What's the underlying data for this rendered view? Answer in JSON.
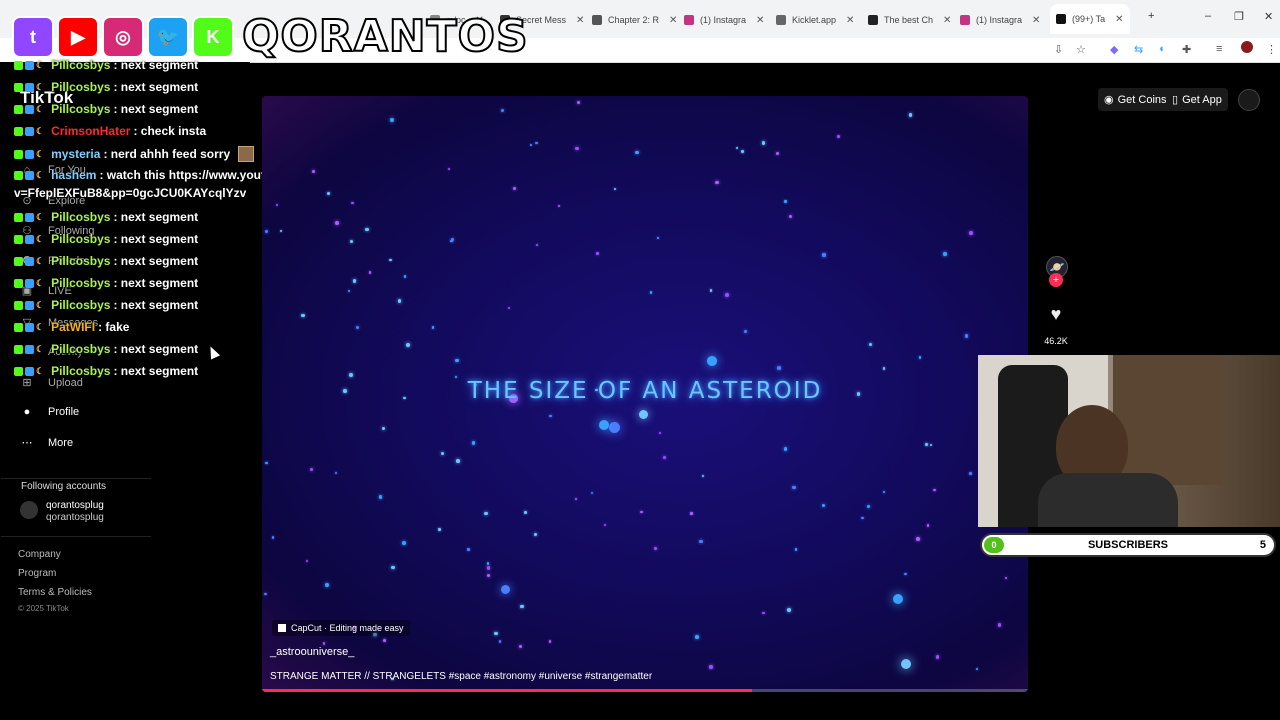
{
  "browser": {
    "tabs": [
      {
        "label": "m/pc",
        "color": "#888888"
      },
      {
        "label": "Secret Mess",
        "color": "#333333"
      },
      {
        "label": "Chapter 2: R",
        "color": "#555555"
      },
      {
        "label": "(1) Instagra",
        "color": "#c13584"
      },
      {
        "label": "Kicklet.app",
        "color": "#666666"
      },
      {
        "label": "The best Ch",
        "color": "#222222"
      },
      {
        "label": "(1) Instagra",
        "color": "#c13584"
      },
      {
        "label": "(99+) Ta",
        "color": "#111111"
      }
    ],
    "new_tab": "+",
    "minimize": "–",
    "restore": "❐",
    "close": "✕"
  },
  "overlay": {
    "brand": "QORANTOS",
    "logos": [
      {
        "name": "twitch-icon",
        "glyph": "t",
        "color": "#9146ff"
      },
      {
        "name": "youtube-icon",
        "glyph": "▶",
        "color": "#ff0000"
      },
      {
        "name": "instagram-icon",
        "glyph": "◎",
        "color": "#d62976"
      },
      {
        "name": "twitter-icon",
        "glyph": "🐦",
        "color": "#1da1f2"
      },
      {
        "name": "kick-icon",
        "glyph": "K",
        "color": "#53fc18"
      }
    ]
  },
  "tiktok": {
    "logo": "TikTok",
    "nav": [
      {
        "label": "For You",
        "icon": "home-icon",
        "glyph": "⌂"
      },
      {
        "label": "Explore",
        "icon": "explore-icon",
        "glyph": "⊙"
      },
      {
        "label": "Following",
        "icon": "following-icon",
        "glyph": "⚇"
      },
      {
        "label": "Friends",
        "icon": "friends-icon",
        "glyph": "⚉"
      },
      {
        "label": "LIVE",
        "icon": "live-icon",
        "glyph": "▣"
      },
      {
        "label": "Messages",
        "icon": "messages-icon",
        "glyph": "▽"
      },
      {
        "label": "Activity",
        "icon": "activity-icon",
        "glyph": "◔"
      },
      {
        "label": "Upload",
        "icon": "upload-icon",
        "glyph": "⊞"
      },
      {
        "label": "Profile",
        "icon": "profile-icon",
        "glyph": "●"
      },
      {
        "label": "More",
        "icon": "more-icon",
        "glyph": "⋯"
      }
    ],
    "following_heading": "Following accounts",
    "following_account": {
      "name": "qorantosplug",
      "handle": "qorantosplug"
    },
    "footer": [
      "Company",
      "Program",
      "Terms & Policies"
    ],
    "copyright": "© 2025 TikTok",
    "get_coins": "Get Coins",
    "get_app": "Get App",
    "like_count": "46.2K"
  },
  "chat": [
    {
      "user": "Pillcosbys",
      "color": "#a8f05a",
      "msg": ": next segment"
    },
    {
      "user": "Pillcosbys",
      "color": "#a8f05a",
      "msg": ": next segment"
    },
    {
      "user": "Pillcosbys",
      "color": "#a8f05a",
      "msg": ": next segment"
    },
    {
      "user": "CrimsonHater",
      "color": "#ff2a2a",
      "msg": ": check insta"
    },
    {
      "user": "mysteria",
      "color": "#7fd0ff",
      "msg": ": nerd ahhh feed sorry"
    },
    {
      "user": "hashem",
      "color": "#7fd0ff",
      "msg": ": watch this https://www.youtube.com/watch?"
    },
    {
      "user": "",
      "color": "#ffffff",
      "msg": "v=FfeplEXFuB8&pp=0gcJCU0KAYcqlYzv"
    },
    {
      "user": "Pillcosbys",
      "color": "#a8f05a",
      "msg": ": next segment"
    },
    {
      "user": "Pillcosbys",
      "color": "#a8f05a",
      "msg": ": next segment"
    },
    {
      "user": "Pillcosbys",
      "color": "#a8f05a",
      "msg": ": next segment"
    },
    {
      "user": "Pillcosbys",
      "color": "#a8f05a",
      "msg": ": next segment"
    },
    {
      "user": "Pillcosbys",
      "color": "#a8f05a",
      "msg": ": next segment"
    },
    {
      "user": "PatWIFI",
      "color": "#f0b020",
      "msg": ": fake"
    },
    {
      "user": "Pillcosbys",
      "color": "#a8f05a",
      "msg": ": next segment"
    },
    {
      "user": "Pillcosbys",
      "color": "#a8f05a",
      "msg": ": next segment"
    }
  ],
  "video": {
    "title": "THE SIZE OF AN ASTEROID",
    "capcut": "CapCut · Editing made easy",
    "author": "_astroouniverse_",
    "description": "STRANGE MATTER // STRANGELETS #space #astronomy #universe #strangematter",
    "progress": 0.64
  },
  "subgoal": {
    "current": "0",
    "label": "SUBSCRIBERS",
    "target": "5"
  }
}
